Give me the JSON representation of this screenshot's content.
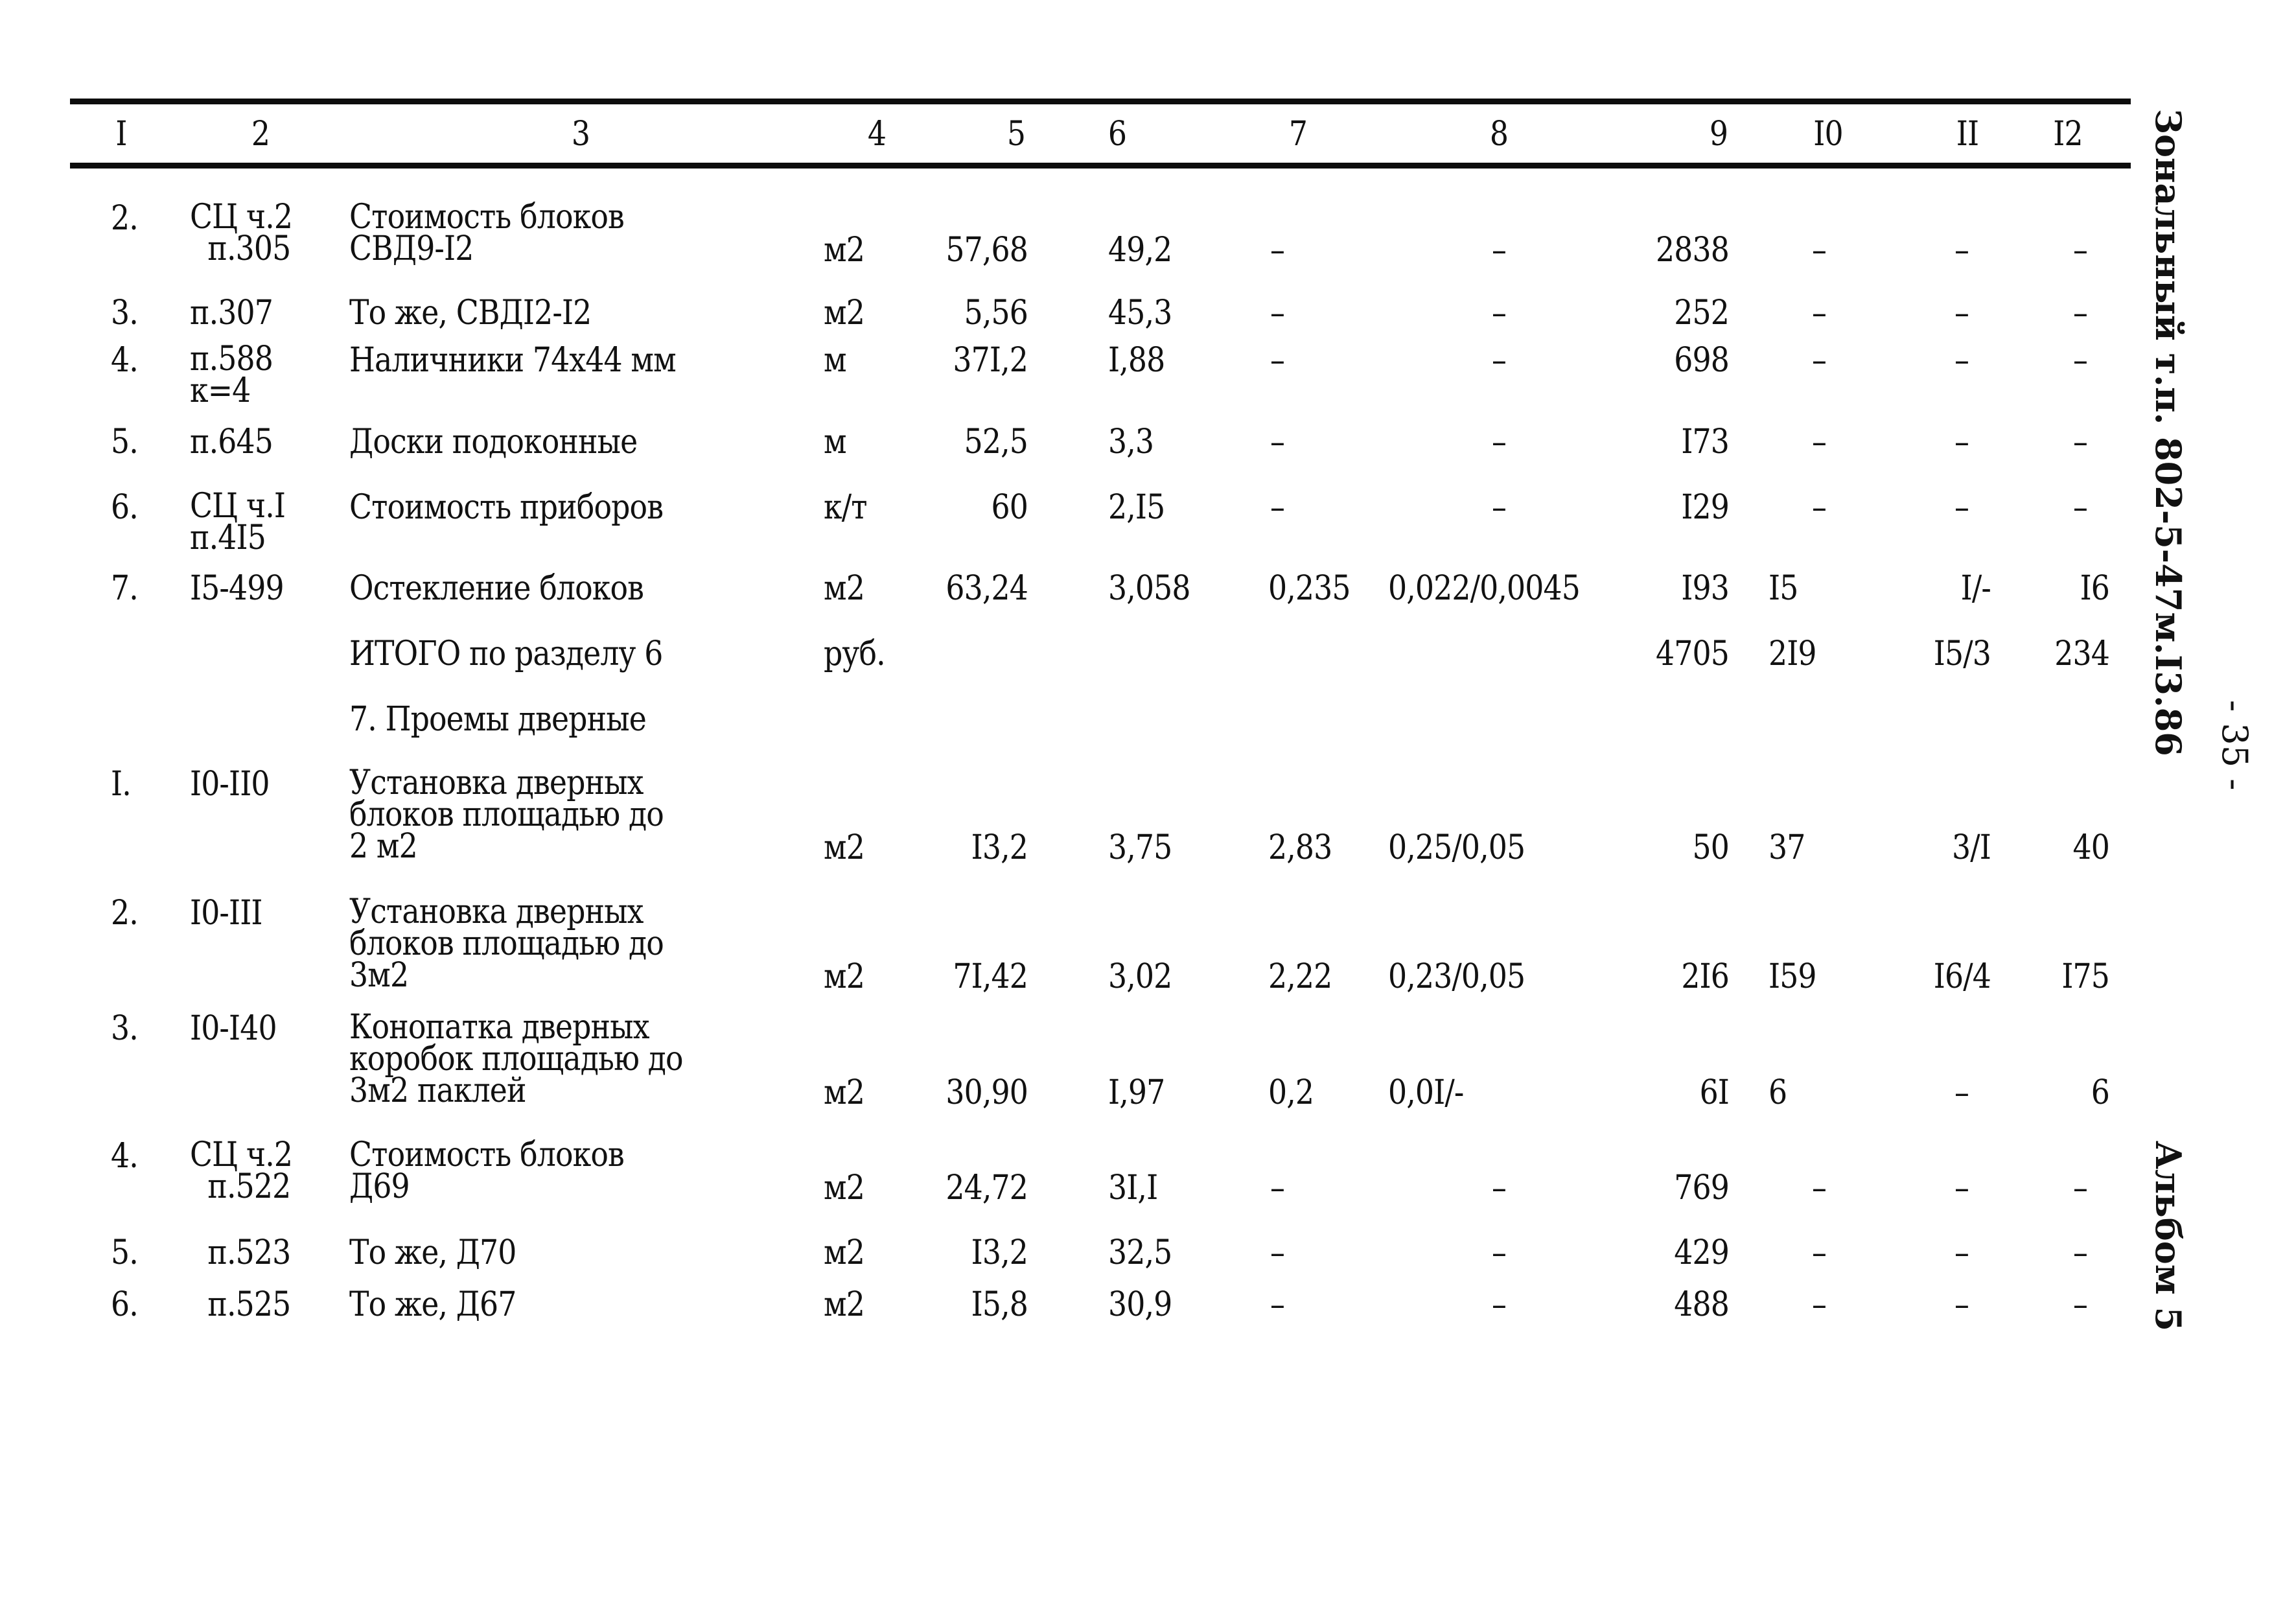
{
  "header": {
    "columns": [
      "I",
      "2",
      "3",
      "4",
      "5",
      "6",
      "7",
      "8",
      "9",
      "I0",
      "II",
      "I2"
    ]
  },
  "section6_rows": [
    {
      "num": "2.",
      "ref": "СЦ ч.2\n  п.305",
      "name": "Стоимость блоков\nСВД9-I2",
      "unit": "м2",
      "c5": "57,68",
      "c6": "49,2",
      "c7": "–",
      "c8": "–",
      "c9": "2838",
      "c10": "–",
      "c11": "–",
      "c12": "–"
    },
    {
      "num": "3.",
      "ref": "п.307",
      "name": "То же, СВДI2-I2",
      "unit": "м2",
      "c5": "5,56",
      "c6": "45,3",
      "c7": "–",
      "c8": "–",
      "c9": "252",
      "c10": "–",
      "c11": "–",
      "c12": "–"
    },
    {
      "num": "4.",
      "ref": "п.588\nк=4",
      "name": "Наличники 74х44 мм",
      "unit": "м",
      "c5": "37I,2",
      "c6": "I,88",
      "c7": "–",
      "c8": "–",
      "c9": "698",
      "c10": "–",
      "c11": "–",
      "c12": "–"
    },
    {
      "num": "5.",
      "ref": "п.645",
      "name": "Доски подоконные",
      "unit": "м",
      "c5": "52,5",
      "c6": "3,3",
      "c7": "–",
      "c8": "–",
      "c9": "I73",
      "c10": "–",
      "c11": "–",
      "c12": "–"
    },
    {
      "num": "6.",
      "ref": "СЦ ч.I\nп.4I5",
      "name": "Стоимость приборов",
      "unit": "к/т",
      "c5": "60",
      "c6": "2,I5",
      "c7": "–",
      "c8": "–",
      "c9": "I29",
      "c10": "–",
      "c11": "–",
      "c12": "–"
    },
    {
      "num": "7.",
      "ref": "I5-499",
      "name": "Остекление блоков",
      "unit": "м2",
      "c5": "63,24",
      "c6": "3,058",
      "c7": "0,235",
      "c8": "0,022/0,0045",
      "c9": "I93",
      "c10": "I5",
      "c11": "I/-",
      "c12": "I6"
    }
  ],
  "section6_total": {
    "name": "ИТОГО по разделу 6",
    "unit": "руб.",
    "c9": "4705",
    "c10": "2I9",
    "c11": "I5/3",
    "c12": "234"
  },
  "section7_title": "7. Проемы дверные",
  "section7_rows": [
    {
      "num": "I.",
      "ref": "I0-II0",
      "name": "Установка дверных\nблоков площадью до\n2 м2",
      "unit": "м2",
      "c5": "I3,2",
      "c6": "3,75",
      "c7": "2,83",
      "c8": "0,25/0,05",
      "c9": "50",
      "c10": "37",
      "c11": "3/I",
      "c12": "40"
    },
    {
      "num": "2.",
      "ref": "I0-III",
      "name": "Установка дверных\nблоков площадью до\n3м2",
      "unit": "м2",
      "c5": "7I,42",
      "c6": "3,02",
      "c7": "2,22",
      "c8": "0,23/0,05",
      "c9": "2I6",
      "c10": "I59",
      "c11": "I6/4",
      "c12": "I75"
    },
    {
      "num": "3.",
      "ref": "I0-I40",
      "name": "Конопатка дверных\nкоробок площадью до\n3м2 паклей",
      "unit": "м2",
      "c5": "30,90",
      "c6": "I,97",
      "c7": "0,2",
      "c8": "0,0I/-",
      "c9": "6I",
      "c10": "6",
      "c11": "–",
      "c12": "6"
    },
    {
      "num": "4.",
      "ref": "СЦ ч.2\n  п.522",
      "name": "Стоимость блоков\nД69",
      "unit": "м2",
      "c5": "24,72",
      "c6": "3I,I",
      "c7": "–",
      "c8": "–",
      "c9": "769",
      "c10": "–",
      "c11": "–",
      "c12": "–"
    },
    {
      "num": "5.",
      "ref": "  п.523",
      "name": "То же, Д70",
      "unit": "м2",
      "c5": "I3,2",
      "c6": "32,5",
      "c7": "–",
      "c8": "–",
      "c9": "429",
      "c10": "–",
      "c11": "–",
      "c12": "–"
    },
    {
      "num": "6.",
      "ref": "  п.525",
      "name": "То же, Д67",
      "unit": "м2",
      "c5": "I5,8",
      "c6": "30,9",
      "c7": "–",
      "c8": "–",
      "c9": "488",
      "c10": "–",
      "c11": "–",
      "c12": "–"
    }
  ],
  "margin": {
    "project_code": "Зональный т.п. 802-5-47м.I3.86",
    "page_number": "- 35 -",
    "album": "Альбом 5"
  }
}
